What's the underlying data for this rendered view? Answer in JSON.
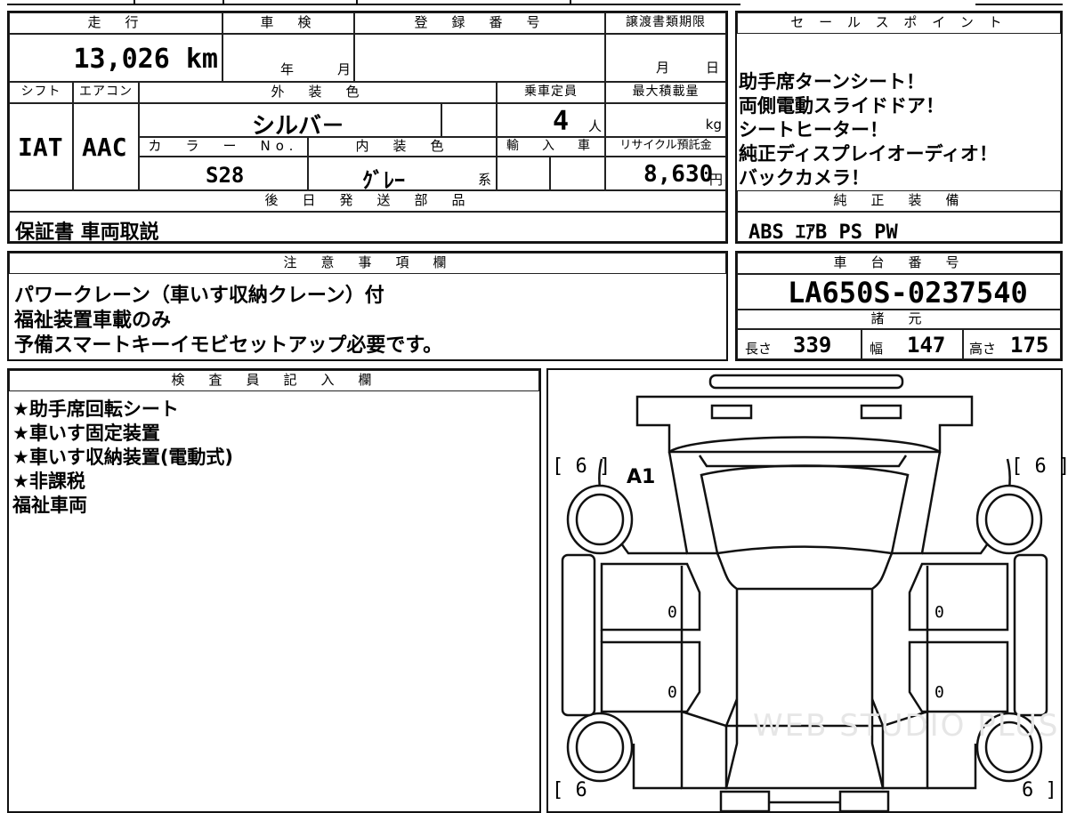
{
  "top": {
    "mileage_header": "走　行",
    "inspection_header": "車　検",
    "registration_header": "登　録　番　号",
    "transfer_deadline_header": "譲渡書類期限",
    "sales_header": "セ ー ル ス ポ イ ン ト",
    "mileage": "13,026 km",
    "inspection_year": "年",
    "inspection_month": "月",
    "transfer_month": "月",
    "transfer_day": "日",
    "shift_header": "シフト",
    "ac_header": "エアコン",
    "exterior_header": "外　装　色",
    "capacity_header": "乗車定員",
    "max_load_header": "最大積載量",
    "shift": "IAT",
    "ac": "AAC",
    "exterior_color": "シルバ－",
    "capacity": "4",
    "capacity_unit": "人",
    "max_load_unit": "kg",
    "color_no_header": "カ　ラ　ー　No.",
    "interior_header": "内　装　色",
    "import_header": "輸　入　車",
    "recycle_header": "リサイクル預託金",
    "color_no": "S28",
    "interior_color": "ｸﾞﾚｰ",
    "interior_suffix": "系",
    "recycle_fee": "8,630",
    "recycle_unit": "円",
    "later_parts_header": "後　日　発　送　部　品",
    "later_parts": "保証書 車両取説"
  },
  "sales_points": [
    "助手席ターンシート！",
    "両側電動スライドドア！",
    "シートヒーター！",
    "純正ディスプレイオーディオ！",
    "バックカメラ！"
  ],
  "equipment": {
    "header": "純　正　装　備",
    "value": "ABS  ｴｱB  PS  PW"
  },
  "notes": {
    "header": "注　意　事　項　欄",
    "lines": [
      "パワークレーン（車いす収納クレーン）付",
      "福祉装置車載のみ",
      "予備スマートキーイモビセットアップ必要です。"
    ]
  },
  "chassis": {
    "header": "車　台　番　号",
    "value": "LA650S-0237540",
    "specs_header": "諸　元",
    "length_label": "長さ",
    "length": "339",
    "width_label": "幅",
    "width": "147",
    "height_label": "高さ",
    "height": "175"
  },
  "inspector": {
    "header": "検　査　員　記　入　欄",
    "lines": [
      "★助手席回転シート",
      "★車いす固定装置",
      "★車いす収納装置(電動式)",
      "★非課税",
      "福祉車両"
    ]
  },
  "diagram": {
    "tire_tl": "[ 6 ]",
    "tire_tr": "[ 6 ]",
    "tire_bl": "[ 6",
    "tire_br": "6 ]",
    "damage_code": "A1",
    "door_left_1": "0",
    "door_left_2": "0",
    "door_right_1": "0",
    "door_right_2": "0",
    "watermark": "WEB STUDIO PLUS"
  }
}
